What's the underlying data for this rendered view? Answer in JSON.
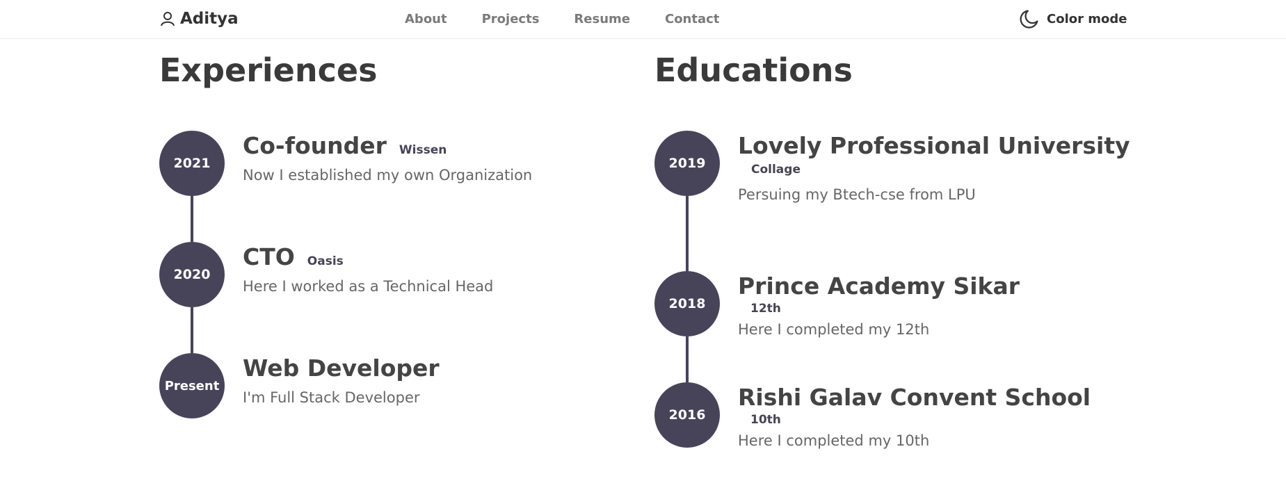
{
  "nav": {
    "brand": "Aditya",
    "links": [
      "About",
      "Projects",
      "Resume",
      "Contact"
    ],
    "color_mode": "Color mode"
  },
  "experiences": {
    "title": "Experiences",
    "items": [
      {
        "year": "2021",
        "title": "Co-founder",
        "badge": "Wissen",
        "desc": "Now I established my own Organization"
      },
      {
        "year": "2020",
        "title": "CTO",
        "badge": "Oasis",
        "desc": "Here I worked as a Technical Head"
      },
      {
        "year": "Present",
        "title": "Web Developer",
        "badge": "",
        "desc": "I'm Full Stack Developer"
      }
    ]
  },
  "educations": {
    "title": "Educations",
    "items": [
      {
        "year": "2019",
        "title": "Lovely Professional University",
        "badge": "Collage",
        "desc": "Persuing my Btech-cse from LPU"
      },
      {
        "year": "2018",
        "title": "Prince Academy Sikar",
        "badge": "12th",
        "desc": "Here I completed my 12th"
      },
      {
        "year": "2016",
        "title": "Rishi Galav Convent School",
        "badge": "10th",
        "desc": "Here I completed my 10th"
      }
    ]
  },
  "colors": {
    "circle": "#47445a",
    "text": "#444444"
  }
}
